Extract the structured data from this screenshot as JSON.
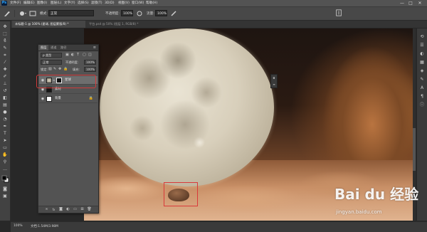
{
  "app": {
    "logo_text": "Ps"
  },
  "menubar": {
    "items": [
      "文件(F)",
      "编辑(E)",
      "图像(I)",
      "图层(L)",
      "文字(Y)",
      "选择(S)",
      "滤镜(T)",
      "3D(D)",
      "视图(V)",
      "窗口(W)",
      "帮助(H)"
    ],
    "window_controls": [
      "—",
      "□",
      "✕"
    ]
  },
  "optionsbar": {
    "mode_label": "模式:",
    "mode_value": "正常",
    "opacity_label": "不透明度:",
    "opacity_value": "100%",
    "flow_label": "流量:",
    "flow_value": "100%"
  },
  "tabs": [
    {
      "label": "未标题-1 @ 100% (星球, 图层蒙版/8) *",
      "active": true
    },
    {
      "label": "平台.psd @ 50% (图层 1, RGB/8) *",
      "active": false
    }
  ],
  "layers_panel": {
    "tabs": [
      "图层",
      "通道",
      "路径"
    ],
    "filter_label": "ρ 类型",
    "blend_mode": "正常",
    "opacity_label": "不透明度:",
    "opacity_value": "100%",
    "lock_label": "锁定:",
    "fill_label": "填充:",
    "fill_value": "100%",
    "layers": [
      {
        "name": "星球",
        "selected": true,
        "has_mask": true
      },
      {
        "name": "素材",
        "selected": false,
        "has_mask": false
      },
      {
        "name": "背景",
        "selected": false,
        "has_mask": false,
        "locked": true
      }
    ],
    "footer_icons": [
      "link-icon",
      "fx-icon",
      "mask-icon",
      "adjustment-icon",
      "folder-icon",
      "new-layer-icon",
      "trash-icon"
    ]
  },
  "statusbar": {
    "zoom": "100%",
    "doc_info": "文档:1.54M/3.98M"
  },
  "watermark": {
    "logo": "Bai du 经验",
    "url": "jingyan.baidu.com"
  },
  "colors": {
    "highlight_red": "#d23b3b",
    "panel_bg": "#535353"
  }
}
